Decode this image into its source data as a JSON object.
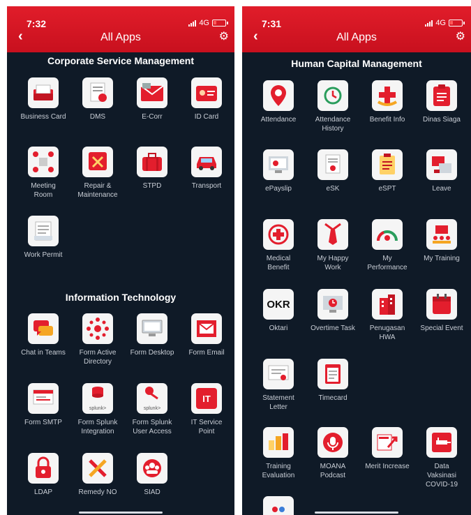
{
  "left_screen": {
    "time": "7:32",
    "network": "4G",
    "title": "All Apps",
    "sections": [
      {
        "title": "Corporate Service Management",
        "apps": [
          {
            "label": "Business Card",
            "icon": "business-card-icon"
          },
          {
            "label": "DMS",
            "icon": "document-icon"
          },
          {
            "label": "E-Corr",
            "icon": "mail-icon"
          },
          {
            "label": "ID Card",
            "icon": "id-card-icon"
          },
          {
            "label": "Meeting\nRoom",
            "icon": "meeting-room-icon"
          },
          {
            "label": "Repair &\nMaintenance",
            "icon": "repair-icon"
          },
          {
            "label": "STPD",
            "icon": "briefcase-icon"
          },
          {
            "label": "Transport",
            "icon": "car-icon"
          },
          {
            "label": "Work Permit",
            "icon": "permit-icon"
          }
        ]
      },
      {
        "title": "Information Technology",
        "apps": [
          {
            "label": "Chat in Teams",
            "icon": "chat-icon"
          },
          {
            "label": "Form Active\nDirectory",
            "icon": "network-icon"
          },
          {
            "label": "Form Desktop",
            "icon": "desktop-icon"
          },
          {
            "label": "Form Email",
            "icon": "email-form-icon"
          },
          {
            "label": "Form SMTP",
            "icon": "smtp-icon"
          },
          {
            "label": "Form Splunk\nIntegration",
            "icon": "splunk-database-icon",
            "text": "splunk>"
          },
          {
            "label": "Form Splunk\nUser Access",
            "icon": "splunk-key-icon",
            "text": "splunk>"
          },
          {
            "label": "IT Service\nPoint",
            "icon": "it-service-icon",
            "text": "IT"
          },
          {
            "label": "LDAP",
            "icon": "lock-icon"
          },
          {
            "label": "Remedy NO",
            "icon": "tools-icon"
          },
          {
            "label": "SIAD",
            "icon": "team-icon"
          }
        ]
      }
    ]
  },
  "right_screen": {
    "time": "7:31",
    "network": "4G",
    "title": "All Apps",
    "sections": [
      {
        "title": "Human Capital Management",
        "apps": [
          {
            "label": "Attendance",
            "icon": "location-pin-icon"
          },
          {
            "label": "Attendance\nHistory",
            "icon": "history-icon"
          },
          {
            "label": "Benefit Info",
            "icon": "health-hand-icon"
          },
          {
            "label": "Dinas Siaga",
            "icon": "clipboard-icon"
          },
          {
            "label": "ePayslip",
            "icon": "payslip-icon"
          },
          {
            "label": "eSK",
            "icon": "certificate-icon"
          },
          {
            "label": "eSPT",
            "icon": "checklist-icon"
          },
          {
            "label": "Leave",
            "icon": "leave-icon"
          },
          {
            "label": "Medical\nBenefit",
            "icon": "medical-icon"
          },
          {
            "label": "My Happy\nWork",
            "icon": "tie-icon"
          },
          {
            "label": "My\nPerformance",
            "icon": "performance-icon"
          },
          {
            "label": "My Training",
            "icon": "training-icon"
          },
          {
            "label": "Oktari",
            "icon": "okr-icon",
            "text": "OKR"
          },
          {
            "label": "Overtime Task",
            "icon": "overtime-icon"
          },
          {
            "label": "Penugasan\nHWA",
            "icon": "building-icon"
          },
          {
            "label": "Special Event",
            "icon": "calendar-icon"
          },
          {
            "label": "Statement\nLetter",
            "icon": "letter-icon"
          },
          {
            "label": "Timecard",
            "icon": "timecard-icon"
          },
          {
            "label": "Training\nEvaluation",
            "icon": "evaluation-icon"
          },
          {
            "label": "MOANA\nPodcast",
            "icon": "podcast-icon"
          },
          {
            "label": "Merit Increase",
            "icon": "merit-icon"
          },
          {
            "label": "Data\nVaksinasi\nCOVID-19",
            "icon": "vaccine-icon"
          },
          {
            "label": "",
            "icon": "partial-app-icon"
          }
        ]
      }
    ]
  },
  "colors": {
    "header_red": "#d8192a",
    "background": "#0f1a27",
    "accent_red": "#e31e2d"
  }
}
